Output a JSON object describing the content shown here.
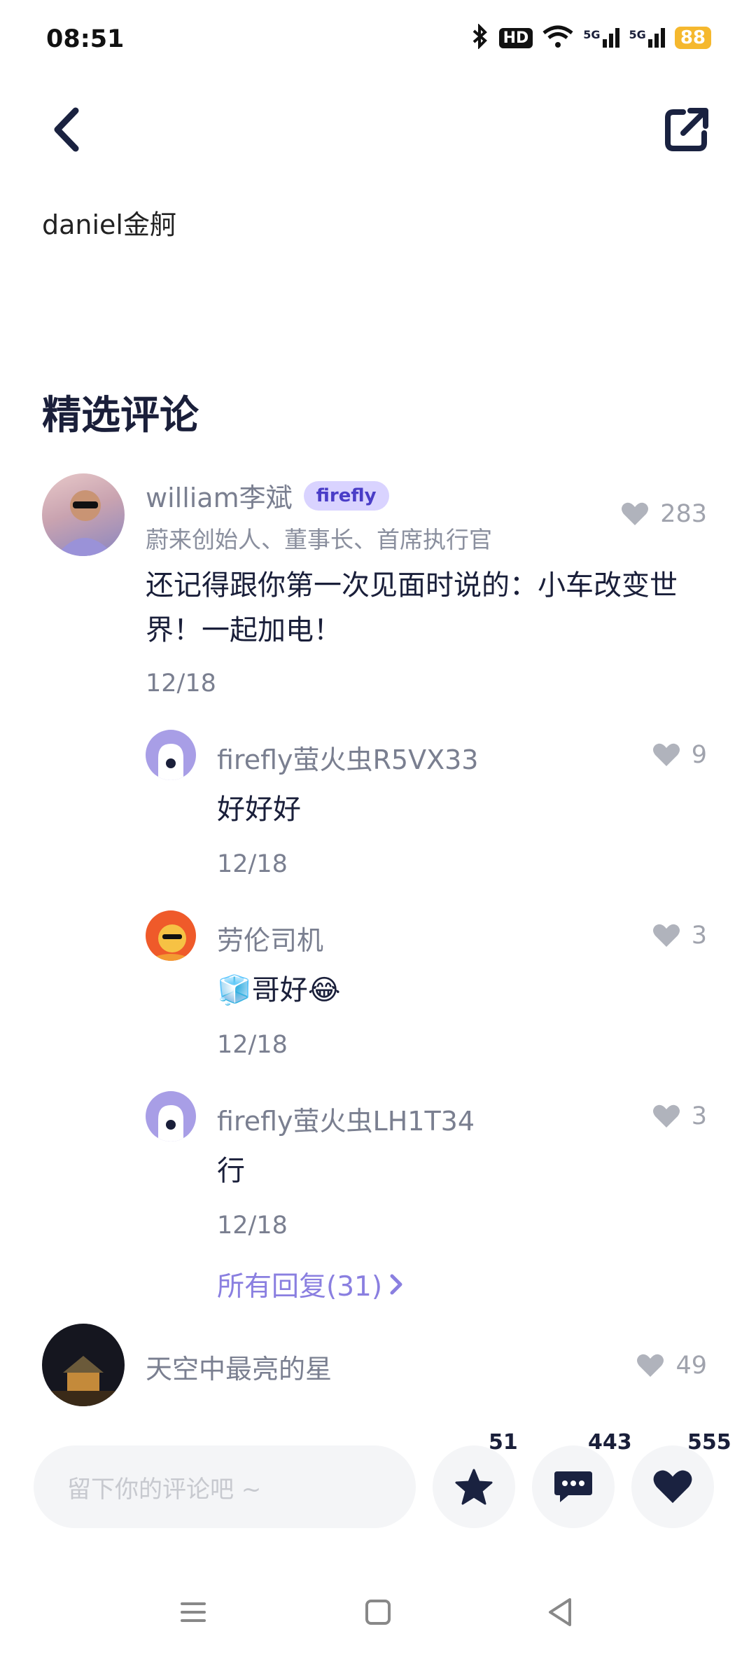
{
  "status_bar": {
    "time": "08:51",
    "battery": "88",
    "hd_label": "HD",
    "network_1": "5G",
    "network_2": "5G"
  },
  "post": {
    "author_line": "daniel金舸"
  },
  "section": {
    "title": "精选评论"
  },
  "comments": [
    {
      "name": "william李斌",
      "badge": "firefly",
      "subtitle": "蔚来创始人、董事长、首席执行官",
      "likes": "283",
      "text": "还记得跟你第一次见面时说的：小车改变世界！一起加电！",
      "date": "12/18",
      "replies": [
        {
          "name": "firefly萤火虫R5VX33",
          "likes": "9",
          "text": "好好好",
          "date": "12/18"
        },
        {
          "name": "劳伦司机",
          "likes": "3",
          "text": "🧊哥好😂",
          "date": "12/18"
        },
        {
          "name": "firefly萤火虫LH1T34",
          "likes": "3",
          "text": "行",
          "date": "12/18"
        }
      ],
      "all_replies_label": "所有回复(31)"
    },
    {
      "name": "天空中最亮的星",
      "likes": "49"
    }
  ],
  "bottom_bar": {
    "input_placeholder": "留下你的评论吧 ~",
    "favorites": "51",
    "comments": "443",
    "likes": "555"
  }
}
